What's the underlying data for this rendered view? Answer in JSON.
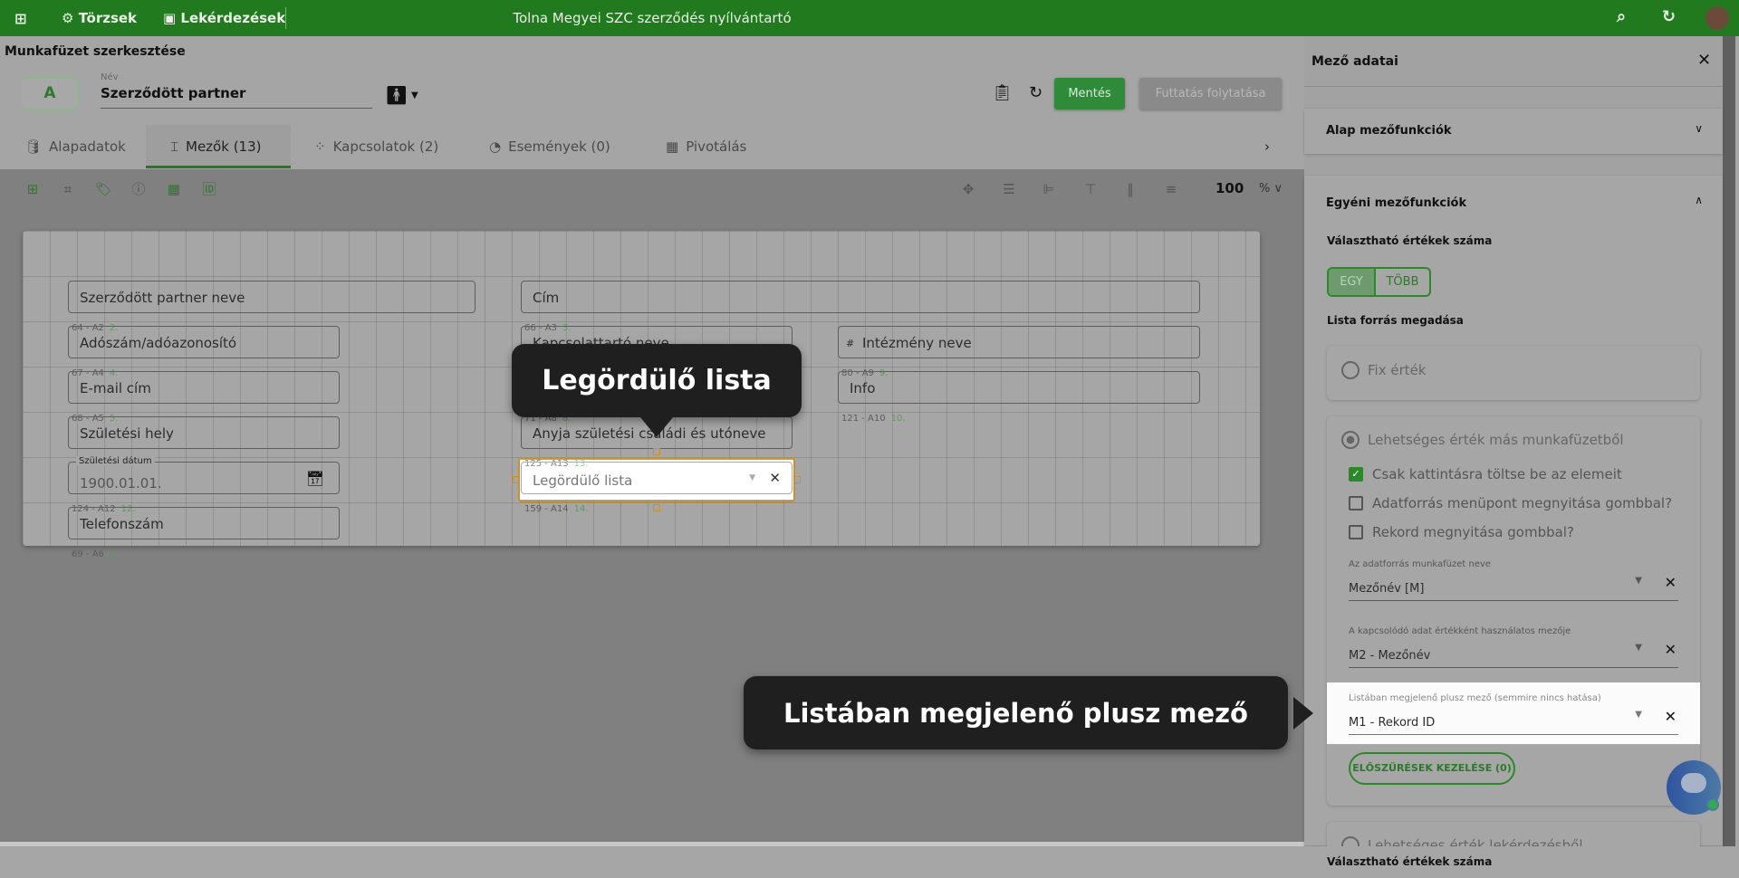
{
  "topbar": {
    "nav": [
      {
        "label": "Törzsek",
        "icon": "hub-icon"
      },
      {
        "label": "Lekérdezések",
        "icon": "sql-icon"
      }
    ],
    "title": "Tolna Megyei SZC szerződés nyílvántartó"
  },
  "editor": {
    "heading": "Munkafüzet szerkesztése",
    "avatar_letter": "A",
    "name_label": "Név",
    "name_value": "Szerződött partner",
    "save": "Mentés",
    "continue": "Futtatás folytatása"
  },
  "tabs": [
    {
      "label": "Alapadatok"
    },
    {
      "label": "Mezők (13)",
      "active": true
    },
    {
      "label": "Kapcsolatok (2)"
    },
    {
      "label": "Események (0)"
    },
    {
      "label": "Pivotálás"
    }
  ],
  "toolbar": {
    "zoom": "100",
    "zoom_unit": "%"
  },
  "fields": [
    {
      "label": "Szerződött partner neve"
    },
    {
      "label": "Cím"
    },
    {
      "label": "Adószám/adóazonosító",
      "cap": "64 - A2",
      "num": "2."
    },
    {
      "label": "Kapcsolattartó neve",
      "cap": "66 - A3",
      "num": "3."
    },
    {
      "label": "Intézmény neve"
    },
    {
      "label": "E-mail cím",
      "cap": "67 - A4",
      "num": "4."
    },
    {
      "label": "Info",
      "cap": "80 - A9",
      "num": "9."
    },
    {
      "label": "Születési hely",
      "cap": "68 - A5",
      "num": "5."
    },
    {
      "label": "Anyja születési családi és utóneve",
      "cap": "71 - A8",
      "num": "8."
    },
    {
      "label": "Születési dátum",
      "value": "1900.01.01."
    },
    {
      "label": "Legördülő lista",
      "cap": "125 - A13",
      "num": "13."
    },
    {
      "label": "Telefonszám",
      "cap": "124 - A12",
      "num": "12."
    }
  ],
  "extra_caps": [
    {
      "cap": "69 - A6",
      "num": "6."
    },
    {
      "cap": "121 - A10",
      "num": "10."
    },
    {
      "cap": "159 - A14",
      "num": "14."
    }
  ],
  "tooltips": {
    "dropdown": "Legördülő lista",
    "extra_field": "Listában megjelenő plusz mező"
  },
  "panel": {
    "title": "Mező adatai",
    "basic": "Alap mezőfunkciók",
    "custom": "Egyéni mezőfunkciók",
    "count_label": "Választható értékek száma",
    "toggle": [
      "EGY",
      "TÖBB"
    ],
    "toggle_selected": "EGY",
    "source_label": "Lista forrás megadása",
    "fix": "Fix érték",
    "other": "Lehetséges érték más munkafüzetből",
    "checks": [
      {
        "label": "Csak kattintásra töltse be az elemeit",
        "checked": true
      },
      {
        "label": "Adatforrás menüpont megnyitása gombbal?",
        "checked": false
      },
      {
        "label": "Rekord megnyitása gombbal?",
        "checked": false
      }
    ],
    "selects": [
      {
        "label": "Az adatforrás munkafüzet neve",
        "value": "Mezőnév [M]"
      },
      {
        "label": "A kapcsolódó adat értékként használatos mezője",
        "value": "M2 - Mezőnév"
      },
      {
        "label": "Listában megjelenő plusz mező (semmire nincs hatása)",
        "value": "M1 - Rekord ID"
      }
    ],
    "prefilter": "ELŐSZŰRÉSEK KEZELÉSE (0)",
    "query": "Lehetséges érték lekérdezésből",
    "bottom_label": "Választható értékek száma"
  },
  "colors": {
    "brand": "#217a1e",
    "accent": "#2e8b3a",
    "highlight": "#c8922a"
  }
}
